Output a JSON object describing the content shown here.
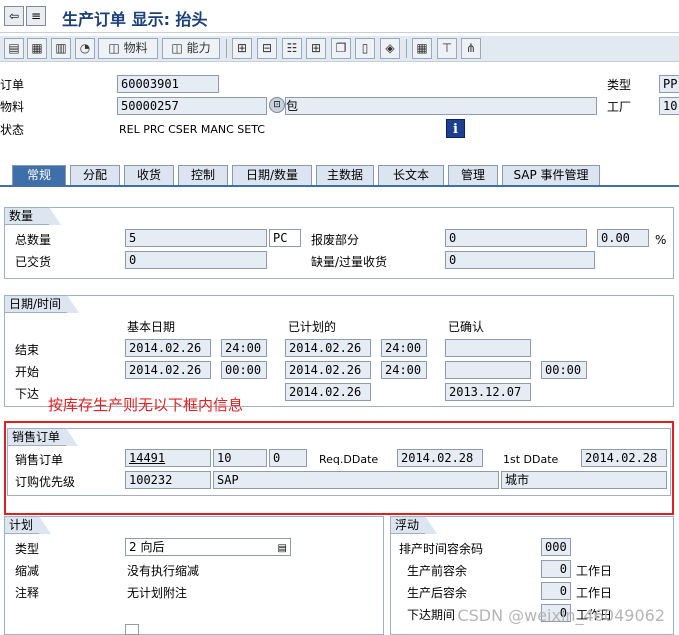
{
  "title": "生产订单 显示: 抬头",
  "toolbar": {
    "material_label": "物料",
    "capacity_label": "能力"
  },
  "header": {
    "order_label": "订单",
    "order_value": "60003901",
    "material_label": "物料",
    "material_value": "50000257",
    "material_desc": "包",
    "status_label": "状态",
    "status_value": "REL  PRC  CSER MANC SETC",
    "type_label": "类型",
    "type_value": "PP",
    "plant_label": "工厂",
    "plant_value": "10"
  },
  "tabs": [
    "常规",
    "分配",
    "收货",
    "控制",
    "日期/数量",
    "主数据",
    "长文本",
    "管理",
    "SAP 事件管理"
  ],
  "quantity": {
    "head": "数量",
    "total_label": "总数量",
    "total_value": "5",
    "unit": "PC",
    "scrap_label": "报废部分",
    "scrap_value": "0",
    "scrap_pct": "0.00",
    "pct_sign": "%",
    "delivered_label": "已交货",
    "delivered_value": "0",
    "shortage_label": "缺量/过量收货",
    "shortage_value": "0"
  },
  "dates": {
    "head": "日期/时间",
    "col_basic": "基本日期",
    "col_scheduled": "已计划的",
    "col_confirmed": "已确认",
    "end_label": "结束",
    "start_label": "开始",
    "release_label": "下达",
    "end_basic_date": "2014.02.26",
    "end_basic_time": "24:00",
    "end_sched_date": "2014.02.26",
    "end_sched_time": "24:00",
    "start_basic_date": "2014.02.26",
    "start_basic_time": "00:00",
    "start_sched_date": "2014.02.26",
    "start_sched_time": "24:00",
    "start_conf_time": "00:00",
    "release_sched_date": "2014.02.26",
    "release_conf_date": "2013.12.07"
  },
  "annotation": "按库存生产则无以下框内信息",
  "sales": {
    "head": "销售订单",
    "order_label": "销售订单",
    "order_value": "14491",
    "item_value": "10",
    "sched_value": "0",
    "req_label": "Req.DDate",
    "req_value": "2014.02.28",
    "first_label": "1st DDate",
    "first_value": "2014.02.28",
    "priority_label": "订购优先级",
    "priority_value": "100232",
    "customer_value": "SAP",
    "city_value": "城市"
  },
  "planning": {
    "head": "计划",
    "type_label": "类型",
    "type_value": "2 向后",
    "reduction_label": "缩减",
    "reduction_value": "没有执行缩减",
    "note_label": "注释",
    "note_value": "无计划附注"
  },
  "float": {
    "head": "浮动",
    "sched_margin_label": "排产时间容余码",
    "sched_margin_value": "000",
    "before_label": "生产前容余",
    "before_value": "0",
    "after_label": "生产后容余",
    "after_value": "0",
    "release_label": "下达期间",
    "release_value": "0",
    "workday": "工作日"
  },
  "watermark": "CSDN @weixin_46049062"
}
